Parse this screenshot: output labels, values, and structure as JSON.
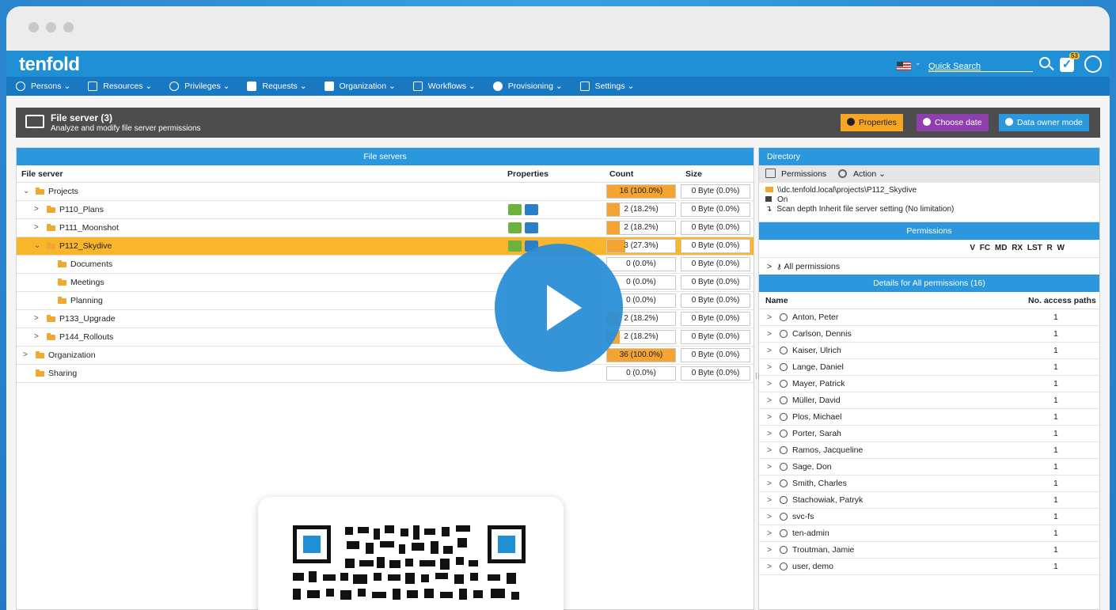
{
  "app": {
    "logo": "tenfold",
    "quick_search": "Quick Search",
    "notifications": "53"
  },
  "nav": [
    "Persons",
    "Resources",
    "Privileges",
    "Requests",
    "Organization",
    "Workflows",
    "Provisioning",
    "Settings"
  ],
  "header": {
    "title": "File server (3)",
    "subtitle": "Analyze and modify file server permissions",
    "buttons": {
      "properties": "Properties",
      "choose_date": "Choose date",
      "data_owner": "Data owner mode"
    },
    "colors": {
      "properties": "#f5a623",
      "choose_date": "#8e3fae",
      "data_owner": "#2b97dd"
    }
  },
  "fileservers": {
    "title": "File servers",
    "columns": {
      "file_server": "File server",
      "properties": "Properties",
      "count": "Count",
      "size": "Size"
    },
    "rows": [
      {
        "name": "Projects",
        "arrow": "⌄",
        "count": "16 (100.0%)",
        "count_pct": 100,
        "size": "0 Byte (0.0%)",
        "props": false
      },
      {
        "name": "P110_Plans",
        "arrow": ">",
        "count": "2 (18.2%)",
        "count_pct": 18.2,
        "size": "0 Byte (0.0%)",
        "props": true
      },
      {
        "name": "P111_Moonshot",
        "arrow": ">",
        "count": "2 (18.2%)",
        "count_pct": 18.2,
        "size": "0 Byte (0.0%)",
        "props": true
      },
      {
        "name": "P112_Skydive",
        "arrow": "⌄",
        "count": "3 (27.3%)",
        "count_pct": 27.3,
        "size": "0 Byte (0.0%)",
        "props": true,
        "selected": true
      },
      {
        "name": "Documents",
        "arrow": "",
        "count": "0 (0.0%)",
        "count_pct": 0,
        "size": "0 Byte (0.0%)",
        "props": false
      },
      {
        "name": "Meetings",
        "arrow": "",
        "count": "0 (0.0%)",
        "count_pct": 0,
        "size": "0 Byte (0.0%)",
        "props": false
      },
      {
        "name": "Planning",
        "arrow": "",
        "count": "0 (0.0%)",
        "count_pct": 0,
        "size": "0 Byte (0.0%)",
        "props": false
      },
      {
        "name": "P133_Upgrade",
        "arrow": ">",
        "count": "2 (18.2%)",
        "count_pct": 18.2,
        "size": "0 Byte (0.0%)",
        "props": false
      },
      {
        "name": "P144_Rollouts",
        "arrow": ">",
        "count": "2 (18.2%)",
        "count_pct": 18.2,
        "size": "0 Byte (0.0%)",
        "props": false
      },
      {
        "name": "Organization",
        "arrow": ">",
        "count": "36 (100.0%)",
        "count_pct": 100,
        "size": "0 Byte (0.0%)",
        "props": false
      },
      {
        "name": "Sharing",
        "arrow": "",
        "count": "0 (0.0%)",
        "count_pct": 0,
        "size": "0 Byte (0.0%)",
        "props": false
      }
    ]
  },
  "directory": {
    "title": "Directory",
    "toolbar": {
      "permissions": "Permissions",
      "action": "Action"
    },
    "path": "\\\\dc.tenfold.local\\projects\\P112_Skydive",
    "lock": "On",
    "scan": "Scan depth Inherit file server setting (No limitation)",
    "permissions_title": "Permissions",
    "perm_cols": "V FC MD RX LST R W",
    "all_permissions": "All permissions",
    "details_title": "Details for All permissions (16)",
    "details_cols": {
      "name": "Name",
      "paths": "No. access paths"
    },
    "people": [
      {
        "name": "Anton, Peter",
        "paths": "1"
      },
      {
        "name": "Carlson, Dennis",
        "paths": "1"
      },
      {
        "name": "Kaiser, Ulrich",
        "paths": "1"
      },
      {
        "name": "Lange, Daniel",
        "paths": "1"
      },
      {
        "name": "Mayer, Patrick",
        "paths": "1"
      },
      {
        "name": "Müller, David",
        "paths": "1"
      },
      {
        "name": "Plos, Michael",
        "paths": "1"
      },
      {
        "name": "Porter, Sarah",
        "paths": "1"
      },
      {
        "name": "Ramos, Jacqueline",
        "paths": "1"
      },
      {
        "name": "Sage, Don",
        "paths": "1"
      },
      {
        "name": "Smith, Charles",
        "paths": "1"
      },
      {
        "name": "Stachowiak, Patryk",
        "paths": "1"
      },
      {
        "name": "svc-fs",
        "paths": "1"
      },
      {
        "name": "ten-admin",
        "paths": "1"
      },
      {
        "name": "Troutman, Jamie",
        "paths": "1"
      },
      {
        "name": "user, demo",
        "paths": "1"
      }
    ]
  }
}
